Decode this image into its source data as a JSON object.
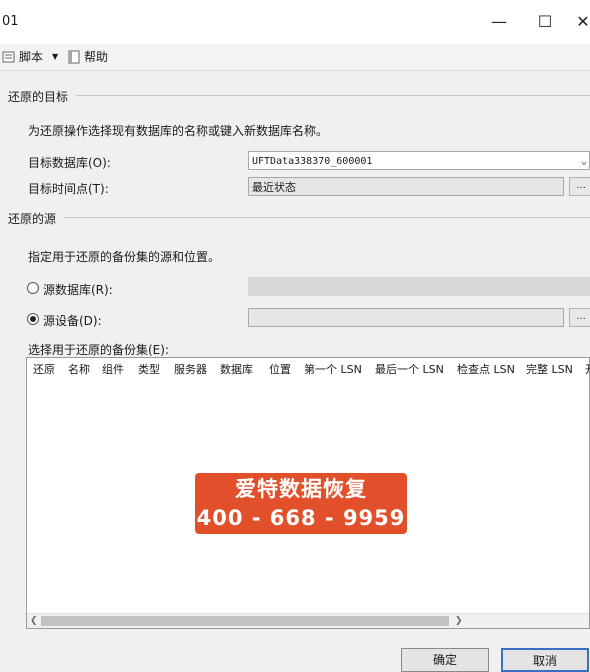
{
  "window": {
    "title": "01"
  },
  "toolbar": {
    "script_label": "脚本",
    "help_label": "帮助"
  },
  "restore_target": {
    "section_label": "还原的目标",
    "instruction": "为还原操作选择现有数据库的名称或键入新数据库名称。",
    "target_db_label": "目标数据库(O):",
    "target_db_value": "UFTData338370_600001",
    "point_in_time_label": "目标时间点(T):",
    "point_in_time_value": "最近状态",
    "browse_label": "..."
  },
  "restore_source": {
    "section_label": "还原的源",
    "instruction": "指定用于还原的备份集的源和位置。",
    "from_database_label": "源数据库(R):",
    "from_device_label": "源设备(D):",
    "from_device_value": "",
    "browse_label": "...",
    "selected_option": "from_device"
  },
  "backup_sets": {
    "label": "选择用于还原的备份集(E):",
    "columns": [
      "还原",
      "名称",
      "组件",
      "类型",
      "服务器",
      "数据库",
      "位置",
      "第一个 LSN",
      "最后一个 LSN",
      "检查点 LSN",
      "完整 LSN",
      "开"
    ],
    "rows": []
  },
  "watermark": {
    "line1": "爱特数据恢复",
    "line2": "400 - 668 - 9959"
  },
  "footer": {
    "ok_label": "确定",
    "cancel_label": "取消"
  },
  "colors": {
    "watermark_bg": "#e2502b",
    "window_bg": "#f0f0f0"
  }
}
